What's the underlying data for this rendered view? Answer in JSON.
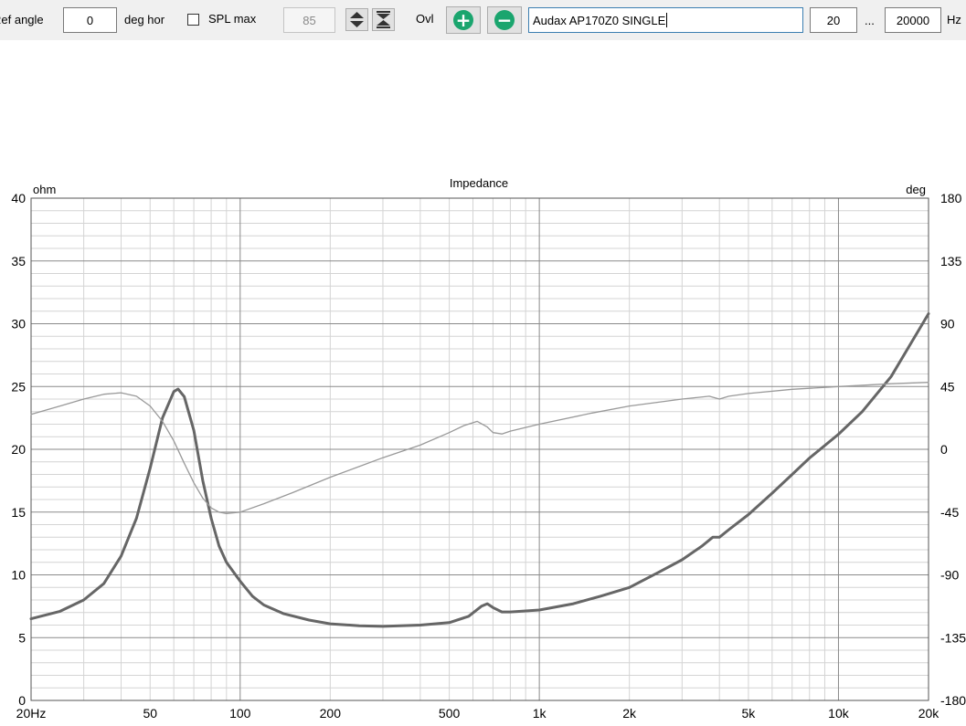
{
  "toolbar": {
    "ref_angle_label": "Ref angle",
    "ref_angle_value": "0",
    "deg_hor_label": "deg hor",
    "spl_max_label": "SPL max",
    "spl_max_value": "85",
    "ovl_label": "Ovl",
    "curve_name": "Audax AP170Z0 SINGLE",
    "freq_min": "20",
    "range_sep": "...",
    "freq_max": "20000",
    "hz_label": "Hz",
    "icons": [
      "up-down-arrows-icon",
      "collapse-arrows-icon",
      "plus-circle-icon",
      "minus-circle-icon"
    ],
    "accent": "#1aa56e"
  },
  "chart_data": {
    "type": "line",
    "title": "Impedance",
    "y_left_unit": "ohm",
    "y_right_unit": "deg",
    "x_scale": "log",
    "xlim": [
      20,
      20000
    ],
    "ylim_left": [
      0,
      40
    ],
    "ylim_right": [
      -180,
      180
    ],
    "x_ticks": [
      {
        "v": 20,
        "label": "20Hz"
      },
      {
        "v": 50,
        "label": "50"
      },
      {
        "v": 100,
        "label": "100"
      },
      {
        "v": 200,
        "label": "200"
      },
      {
        "v": 500,
        "label": "500"
      },
      {
        "v": 1000,
        "label": "1k"
      },
      {
        "v": 2000,
        "label": "2k"
      },
      {
        "v": 5000,
        "label": "5k"
      },
      {
        "v": 10000,
        "label": "10k"
      },
      {
        "v": 20000,
        "label": "20k"
      }
    ],
    "y_left_ticks": [
      "0",
      "5",
      "10",
      "15",
      "20",
      "25",
      "30",
      "35",
      "40"
    ],
    "y_right_ticks": [
      "-180",
      "-135",
      "-90",
      "-45",
      "0",
      "45",
      "90",
      "135",
      "180"
    ],
    "grid": true,
    "series": [
      {
        "axis": "left",
        "color": "#666666",
        "width": 3,
        "points": [
          [
            20,
            6.5
          ],
          [
            25,
            7.1
          ],
          [
            30,
            8.0
          ],
          [
            35,
            9.3
          ],
          [
            40,
            11.5
          ],
          [
            45,
            14.5
          ],
          [
            50,
            18.5
          ],
          [
            55,
            22.5
          ],
          [
            60,
            24.6
          ],
          [
            62,
            24.8
          ],
          [
            65,
            24.2
          ],
          [
            70,
            21.5
          ],
          [
            75,
            17.5
          ],
          [
            80,
            14.5
          ],
          [
            85,
            12.3
          ],
          [
            90,
            11.0
          ],
          [
            100,
            9.5
          ],
          [
            110,
            8.3
          ],
          [
            120,
            7.6
          ],
          [
            140,
            6.9
          ],
          [
            170,
            6.4
          ],
          [
            200,
            6.1
          ],
          [
            250,
            5.95
          ],
          [
            300,
            5.9
          ],
          [
            400,
            6.0
          ],
          [
            500,
            6.2
          ],
          [
            580,
            6.7
          ],
          [
            640,
            7.5
          ],
          [
            670,
            7.7
          ],
          [
            700,
            7.4
          ],
          [
            750,
            7.05
          ],
          [
            800,
            7.05
          ],
          [
            1000,
            7.2
          ],
          [
            1300,
            7.7
          ],
          [
            1600,
            8.3
          ],
          [
            2000,
            9.0
          ],
          [
            2500,
            10.2
          ],
          [
            3000,
            11.2
          ],
          [
            3500,
            12.3
          ],
          [
            3800,
            13.0
          ],
          [
            4000,
            13.0
          ],
          [
            4300,
            13.6
          ],
          [
            5000,
            14.8
          ],
          [
            6000,
            16.5
          ],
          [
            7000,
            18.0
          ],
          [
            8000,
            19.3
          ],
          [
            10000,
            21.2
          ],
          [
            12000,
            23.0
          ],
          [
            15000,
            25.8
          ],
          [
            20000,
            30.8
          ]
        ]
      },
      {
        "axis": "right",
        "color": "#999999",
        "width": 1.3,
        "points": [
          [
            20,
            25
          ],
          [
            25,
            31
          ],
          [
            30,
            36
          ],
          [
            35,
            39.5
          ],
          [
            40,
            40.5
          ],
          [
            45,
            38
          ],
          [
            50,
            31
          ],
          [
            55,
            20
          ],
          [
            60,
            6
          ],
          [
            65,
            -10
          ],
          [
            70,
            -24
          ],
          [
            75,
            -35
          ],
          [
            80,
            -42
          ],
          [
            85,
            -45
          ],
          [
            90,
            -46
          ],
          [
            100,
            -45
          ],
          [
            120,
            -39
          ],
          [
            150,
            -31
          ],
          [
            200,
            -20
          ],
          [
            300,
            -6
          ],
          [
            400,
            3
          ],
          [
            500,
            12
          ],
          [
            560,
            17
          ],
          [
            620,
            20
          ],
          [
            670,
            16
          ],
          [
            700,
            12
          ],
          [
            750,
            11
          ],
          [
            800,
            13
          ],
          [
            1000,
            18
          ],
          [
            1500,
            26
          ],
          [
            2000,
            31
          ],
          [
            3000,
            36
          ],
          [
            3700,
            38
          ],
          [
            4000,
            36
          ],
          [
            4300,
            38
          ],
          [
            5000,
            40
          ],
          [
            7000,
            43
          ],
          [
            10000,
            45
          ],
          [
            15000,
            47
          ],
          [
            20000,
            48
          ]
        ]
      }
    ]
  }
}
